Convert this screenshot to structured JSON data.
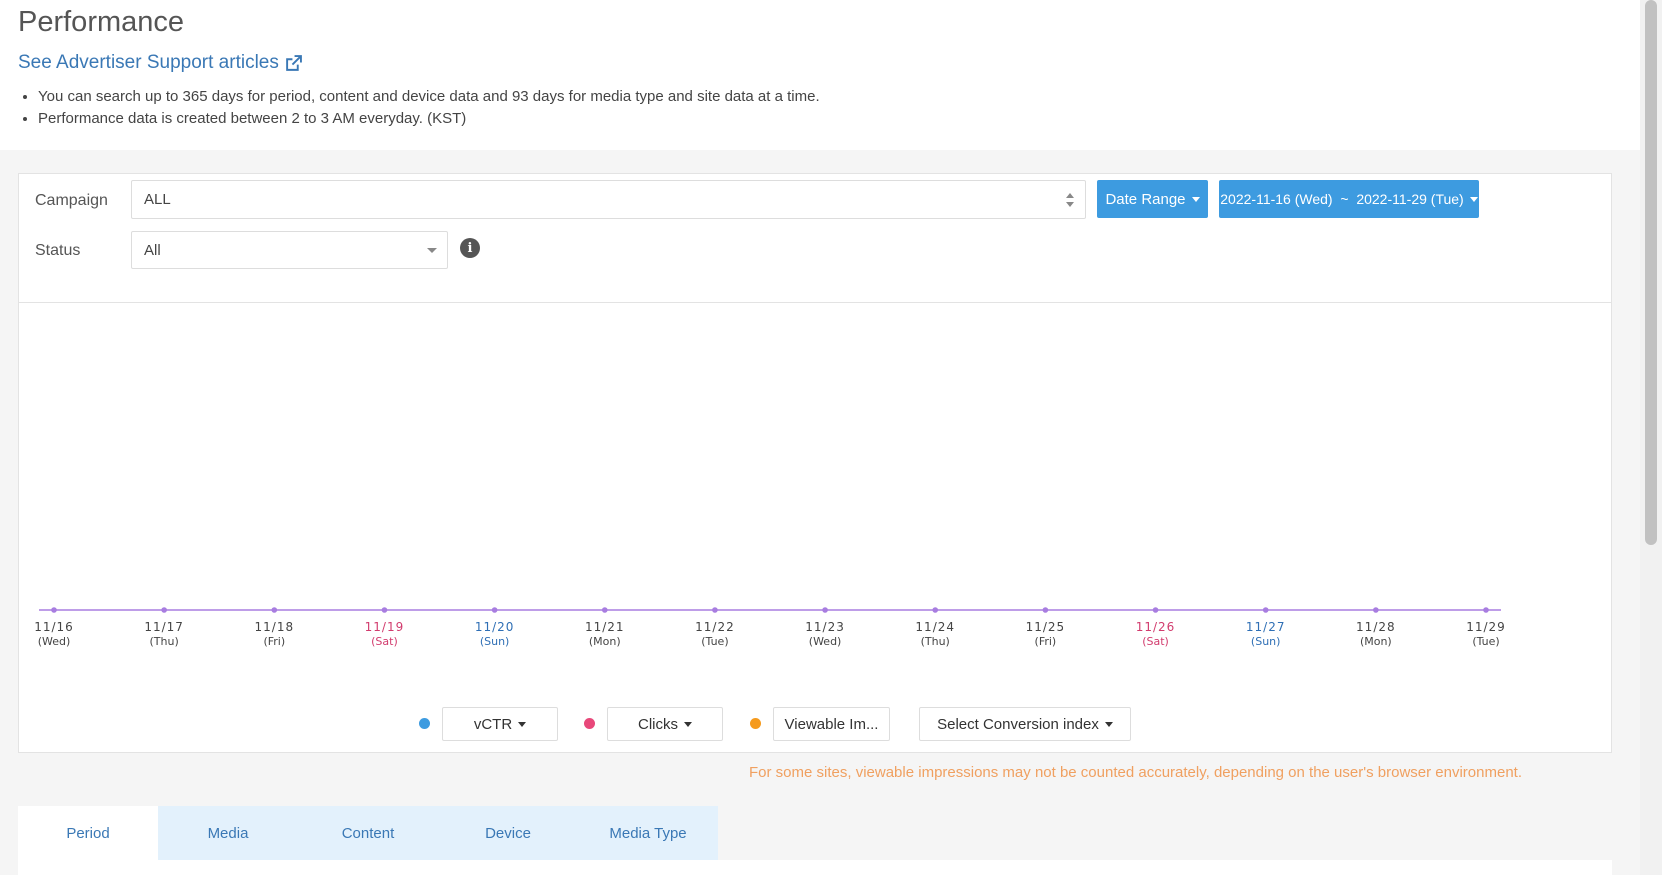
{
  "header": {
    "title": "Performance",
    "support_link": "See Advertiser Support articles",
    "notes": [
      "You can search up to 365 days for period, content and device data and 93 days for media type and site data at a time.",
      "Performance data is created between 2 to 3 AM everyday. (KST)"
    ]
  },
  "filters": {
    "campaign_label": "Campaign",
    "campaign_value": "ALL",
    "status_label": "Status",
    "status_value": "All",
    "date_range_label": "Date Range",
    "date_range_value": "2022-11-16 (Wed)  ~  2022-11-29 (Tue)"
  },
  "chart_data": {
    "type": "line",
    "x": [
      {
        "date": "11/16",
        "day": "(Wed)",
        "kind": "weekday"
      },
      {
        "date": "11/17",
        "day": "(Thu)",
        "kind": "weekday"
      },
      {
        "date": "11/18",
        "day": "(Fri)",
        "kind": "weekday"
      },
      {
        "date": "11/19",
        "day": "(Sat)",
        "kind": "sat"
      },
      {
        "date": "11/20",
        "day": "(Sun)",
        "kind": "sun"
      },
      {
        "date": "11/21",
        "day": "(Mon)",
        "kind": "weekday"
      },
      {
        "date": "11/22",
        "day": "(Tue)",
        "kind": "weekday"
      },
      {
        "date": "11/23",
        "day": "(Wed)",
        "kind": "weekday"
      },
      {
        "date": "11/24",
        "day": "(Thu)",
        "kind": "weekday"
      },
      {
        "date": "11/25",
        "day": "(Fri)",
        "kind": "weekday"
      },
      {
        "date": "11/26",
        "day": "(Sat)",
        "kind": "sat"
      },
      {
        "date": "11/27",
        "day": "(Sun)",
        "kind": "sun"
      },
      {
        "date": "11/28",
        "day": "(Mon)",
        "kind": "weekday"
      },
      {
        "date": "11/29",
        "day": "(Tue)",
        "kind": "weekday"
      }
    ],
    "series": [
      {
        "values": [
          0,
          0,
          0,
          0,
          0,
          0,
          0,
          0,
          0,
          0,
          0,
          0,
          0,
          0
        ],
        "color": "#a87de0"
      }
    ],
    "grid": false
  },
  "legend": {
    "items": [
      {
        "label": "vCTR",
        "color": "#3d9be0",
        "dropdown": true
      },
      {
        "label": "Clicks",
        "color": "#e8487a",
        "dropdown": true
      },
      {
        "label": "Viewable Im...",
        "color": "#f59a1d",
        "dropdown": false
      }
    ],
    "conversion_label": "Select Conversion index"
  },
  "warning": "For some sites, viewable impressions may not be counted accurately, depending on the user's browser environment.",
  "tabs": [
    "Period",
    "Media",
    "Content",
    "Device",
    "Media Type"
  ],
  "colors": {
    "sat": "#d23c6e",
    "sun": "#2f6fb5",
    "weekday": "#444444",
    "accent": "#3d9be0"
  }
}
